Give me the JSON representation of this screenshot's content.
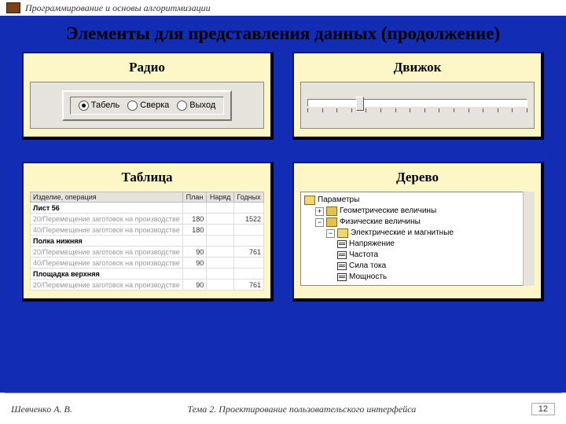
{
  "header": {
    "course": "Программирование и основы алгоритмизации"
  },
  "title": "Элементы для представления данных (продолжение)",
  "cards": {
    "radio": {
      "title": "Радио",
      "options": [
        "Табель",
        "Сверка",
        "Выход"
      ],
      "selected": 0
    },
    "slider": {
      "title": "Движок"
    },
    "table": {
      "title": "Таблица",
      "cols": [
        "Изделие, операция",
        "План",
        "Наряд",
        "Годных"
      ],
      "rows": [
        {
          "group": true,
          "c": [
            "Лист 56",
            "",
            "",
            ""
          ]
        },
        {
          "dim": true,
          "c": [
            "20/Перемещение заготовок на производстве",
            "180",
            "",
            "1522"
          ]
        },
        {
          "dim": true,
          "c": [
            "40/Перемещение заготовок на производстве",
            "180",
            "",
            ""
          ]
        },
        {
          "group": true,
          "c": [
            "Полка нижняя",
            "",
            "",
            ""
          ]
        },
        {
          "dim": true,
          "c": [
            "20/Перемещение заготовок на производстве",
            "90",
            "",
            "761"
          ]
        },
        {
          "dim": true,
          "c": [
            "40/Перемещение заготовок на производстве",
            "90",
            "",
            ""
          ]
        },
        {
          "group": true,
          "c": [
            "Площадка верхняя",
            "",
            "",
            ""
          ]
        },
        {
          "dim": true,
          "c": [
            "20/Перемещение заготовок на производстве",
            "90",
            "",
            "761"
          ]
        }
      ]
    },
    "tree": {
      "title": "Дерево",
      "root": "Параметры",
      "nodes": [
        {
          "toggle": "+",
          "label": "Геометрические величины",
          "folder": true,
          "ind": 1
        },
        {
          "toggle": "−",
          "label": "Физические величины",
          "folder": true,
          "ind": 1
        },
        {
          "toggle": "−",
          "label": "Электрические и магнитные",
          "folder": true,
          "open": true,
          "ind": 2
        },
        {
          "label": "Напряжение",
          "ind": 3
        },
        {
          "label": "Частота",
          "ind": 3
        },
        {
          "label": "Сила тока",
          "ind": 3
        },
        {
          "label": "Мощность",
          "ind": 3
        }
      ]
    }
  },
  "footer": {
    "author": "Шевченко А. В.",
    "topic": "Тема 2. Проектирование пользовательского интерфейса",
    "page": "12"
  }
}
